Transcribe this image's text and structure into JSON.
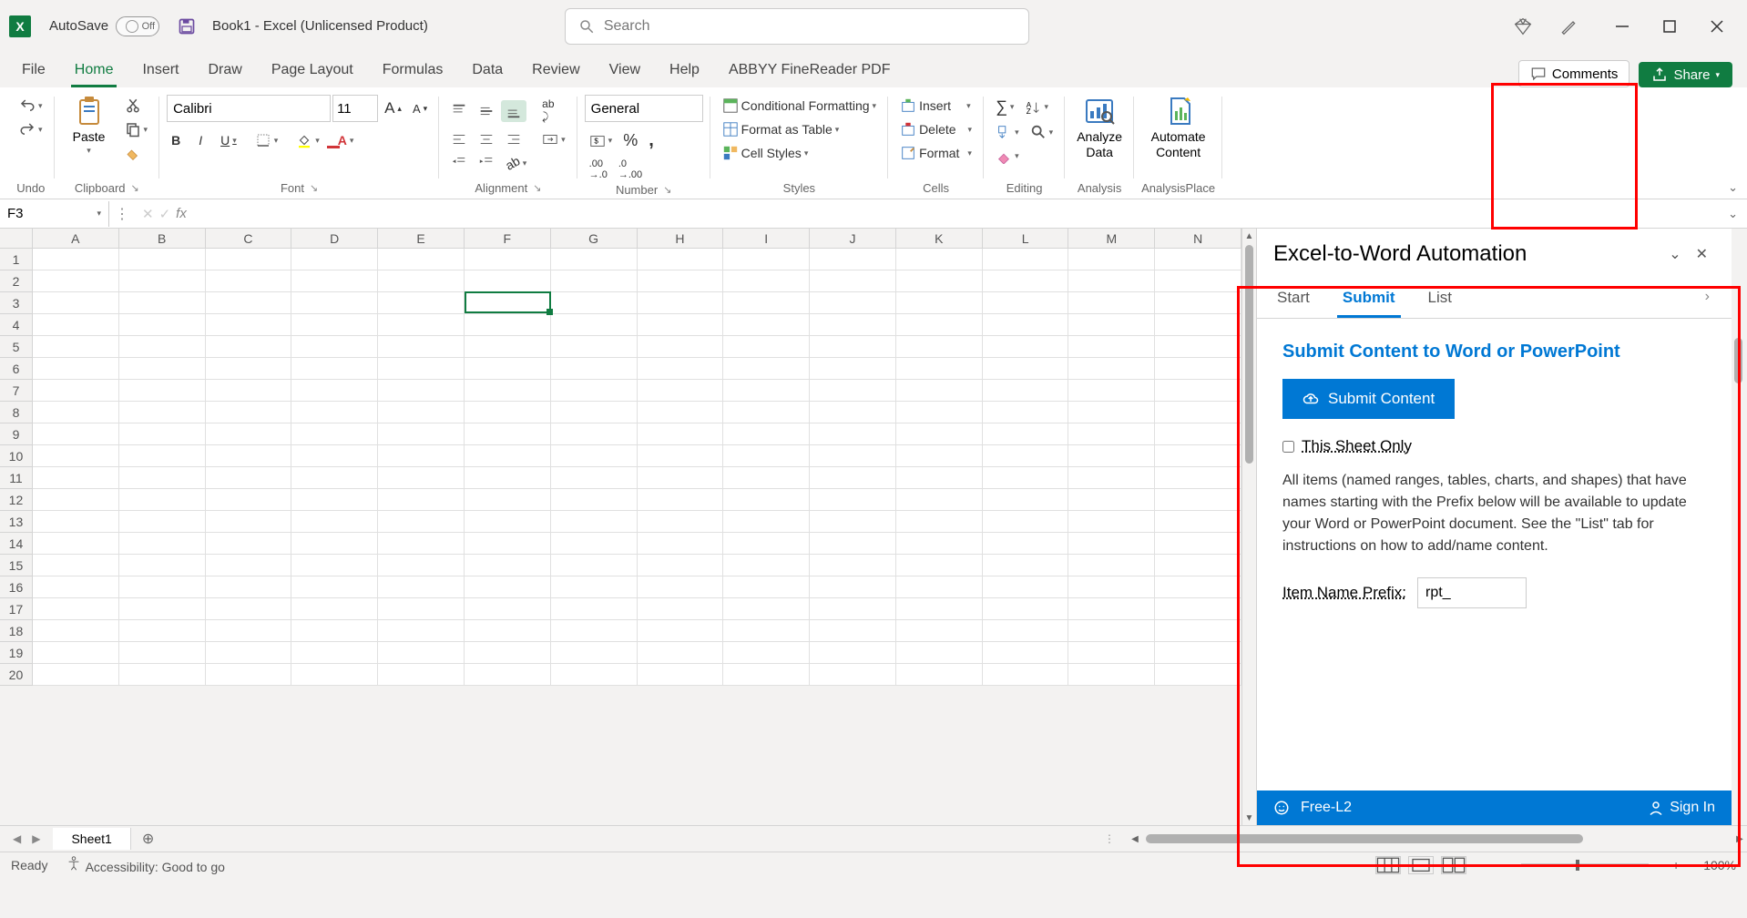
{
  "title": {
    "autosave": "AutoSave",
    "autosave_state": "Off",
    "doc": "Book1  -  Excel (Unlicensed Product)",
    "search_placeholder": "Search"
  },
  "menu": [
    "File",
    "Home",
    "Insert",
    "Draw",
    "Page Layout",
    "Formulas",
    "Data",
    "Review",
    "View",
    "Help",
    "ABBYY FineReader PDF"
  ],
  "menu_active": 1,
  "comments_label": "Comments",
  "share_label": "Share",
  "ribbon": {
    "undo": "Undo",
    "clipboard": "Clipboard",
    "paste_label": "Paste",
    "font": "Font",
    "font_name": "Calibri",
    "font_size": "11",
    "alignment": "Alignment",
    "number": "Number",
    "number_format": "General",
    "styles": "Styles",
    "cond_fmt": "Conditional Formatting",
    "fmt_table": "Format as Table",
    "cell_styles": "Cell Styles",
    "cells": "Cells",
    "insert": "Insert",
    "delete": "Delete",
    "format": "Format",
    "editing": "Editing",
    "analysis": "Analysis",
    "analyze_data": "Analyze Data",
    "analysisplace": "AnalysisPlace",
    "automate_content": "Automate Content"
  },
  "namebox": "F3",
  "columns": [
    "A",
    "B",
    "C",
    "D",
    "E",
    "F",
    "G",
    "H",
    "I",
    "J",
    "K",
    "L",
    "M",
    "N"
  ],
  "row_count": 20,
  "active_cell": {
    "row": 3,
    "col": 6
  },
  "taskpane": {
    "title": "Excel-to-Word Automation",
    "tabs": [
      "Start",
      "Submit",
      "List"
    ],
    "tabs_active": 1,
    "heading": "Submit Content to Word or PowerPoint",
    "submit_btn": "Submit Content",
    "checkbox_label": "This Sheet Only",
    "description": "All items (named ranges, tables, charts, and shapes) that have names starting with the Prefix below will be available to update your Word or PowerPoint document. See the \"List\" tab for instructions on how to add/name content.",
    "prefix_label": "Item Name Prefix:",
    "prefix_value": "rpt_",
    "footer_tier": "Free-L2",
    "footer_signin": "Sign In"
  },
  "sheet_tab": "Sheet1",
  "status": {
    "ready": "Ready",
    "accessibility": "Accessibility: Good to go",
    "zoom": "100%"
  }
}
